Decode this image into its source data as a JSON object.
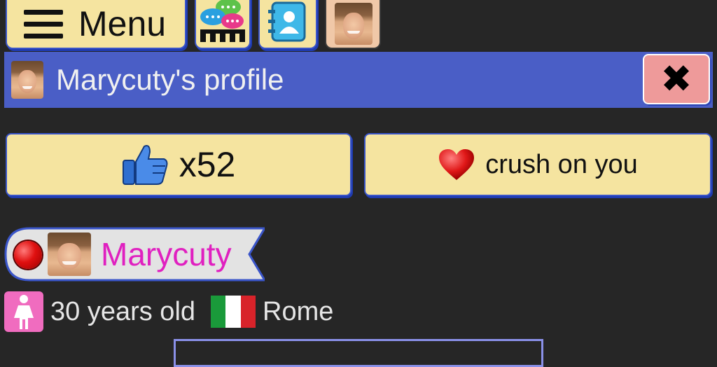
{
  "nav": {
    "menu_label": "Menu",
    "icons": [
      "hamburger-icon",
      "chat-bubbles-icon",
      "address-book-icon",
      "avatar-photo"
    ]
  },
  "header": {
    "title": "Marycuty's profile",
    "close_icon": "close-icon"
  },
  "actions": {
    "like_count": "x52",
    "crush_label": "crush on you"
  },
  "profile": {
    "name": "Marycuty",
    "status": "online-status-icon",
    "age": "30 years old",
    "city": "Rome",
    "gender": "female"
  },
  "colors": {
    "background": "#262626",
    "button_fill": "#f5e4a0",
    "button_border": "#3a55c9",
    "header_bar": "#4a5ec6",
    "close_button": "#ee9a9a",
    "name_color": "#e020c0",
    "gender_icon_bg": "#f06cbf"
  }
}
